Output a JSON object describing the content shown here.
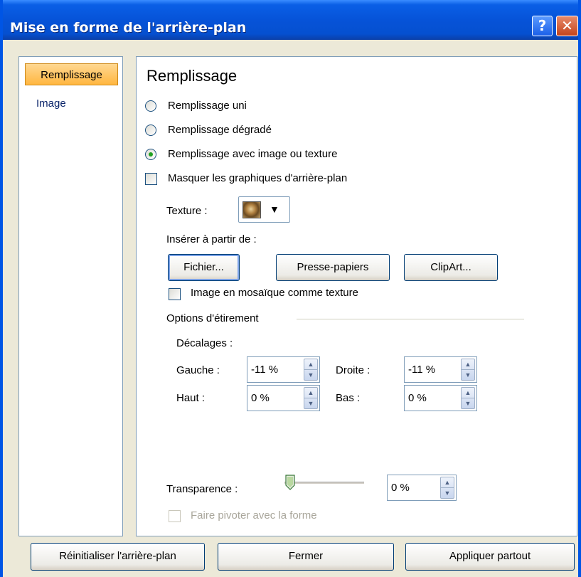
{
  "window": {
    "title": "Mise en forme de l'arrière-plan",
    "help_glyph": "?",
    "close_glyph": "✕"
  },
  "sidebar": {
    "items": [
      {
        "label": "Remplissage",
        "active": true
      },
      {
        "label": "Image",
        "active": false
      }
    ]
  },
  "panel": {
    "heading": "Remplissage",
    "fill_options": [
      {
        "label": "Remplissage uni",
        "checked": false
      },
      {
        "label": "Remplissage dégradé",
        "checked": false
      },
      {
        "label": "Remplissage avec image ou texture",
        "checked": true
      }
    ],
    "hide_graphics": {
      "label": "Masquer les graphiques d'arrière-plan",
      "checked": false
    },
    "texture": {
      "label": "Texture :",
      "dropdown_glyph": "▼"
    },
    "insert_from": {
      "label": "Insérer à partir de :",
      "buttons": [
        "Fichier...",
        "Presse-papiers",
        "ClipArt..."
      ]
    },
    "tile": {
      "label": "Image en mosaïque comme texture",
      "checked": false
    },
    "stretch": {
      "label": "Options d'étirement",
      "offsets_label": "Décalages :",
      "left": {
        "label": "Gauche :",
        "value": "-11 %"
      },
      "right": {
        "label": "Droite :",
        "value": "-11 %"
      },
      "top": {
        "label": "Haut :",
        "value": "0 %"
      },
      "bottom": {
        "label": "Bas :",
        "value": "0 %"
      }
    },
    "transparency": {
      "label": "Transparence :",
      "value": "0 %",
      "level": 0
    },
    "rotate": {
      "label": "Faire pivoter avec la forme",
      "checked": false,
      "enabled": false
    }
  },
  "footer": {
    "buttons": [
      "Réinitialiser l'arrière-plan",
      "Fermer",
      "Appliquer partout"
    ]
  },
  "colors": {
    "titlebar": "#0653d8",
    "active_tab": "#ffb640",
    "radio_dot": "#21a121"
  }
}
